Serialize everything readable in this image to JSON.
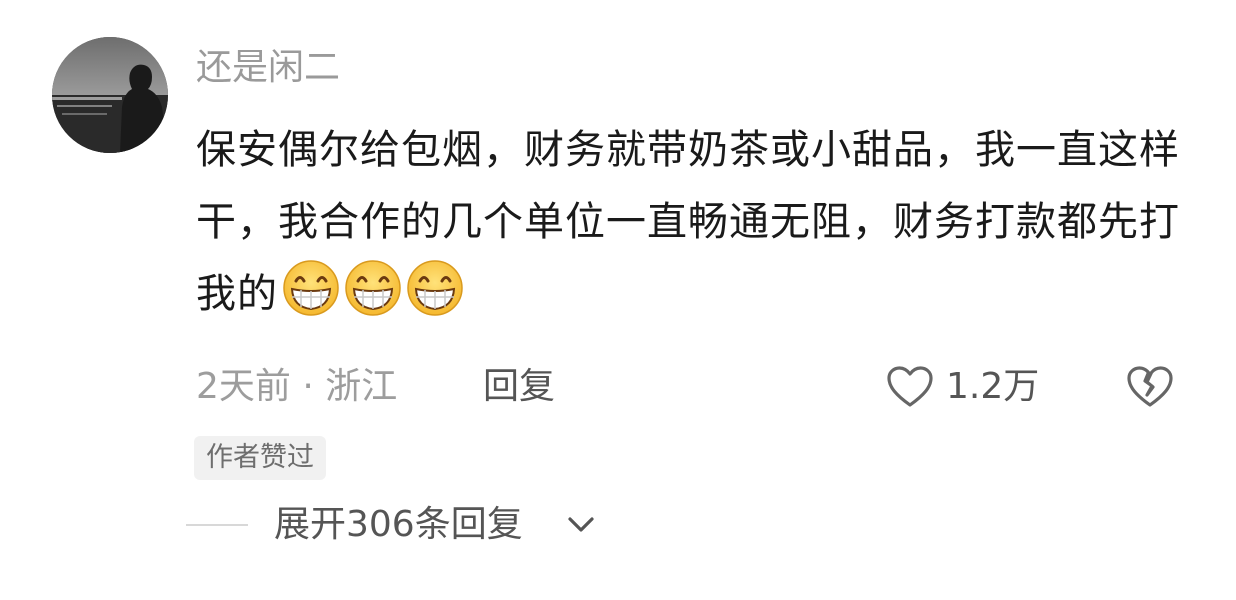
{
  "comment": {
    "username": "还是闲二",
    "text": "保安偶尔给包烟，财务就带奶茶或小甜品，我一直这样干，我合作的几个单位一直畅通无阻，财务打款都先打我的",
    "emojis": [
      "grin-emoji",
      "grin-emoji",
      "grin-emoji"
    ],
    "meta": {
      "time_location": "2天前 · 浙江",
      "reply_label": "回复"
    },
    "likes": {
      "count": "1.2万",
      "icon": "heart-outline-icon"
    },
    "dislike_icon": "broken-heart-icon",
    "author_badge": "作者赞过",
    "expand_replies": {
      "label": "展开306条回复",
      "icon": "chevron-down-icon"
    }
  },
  "colors": {
    "text_primary": "#1a1a1a",
    "text_secondary": "#9a9a9a",
    "text_action": "#555555",
    "badge_bg": "#f1f1f1"
  }
}
